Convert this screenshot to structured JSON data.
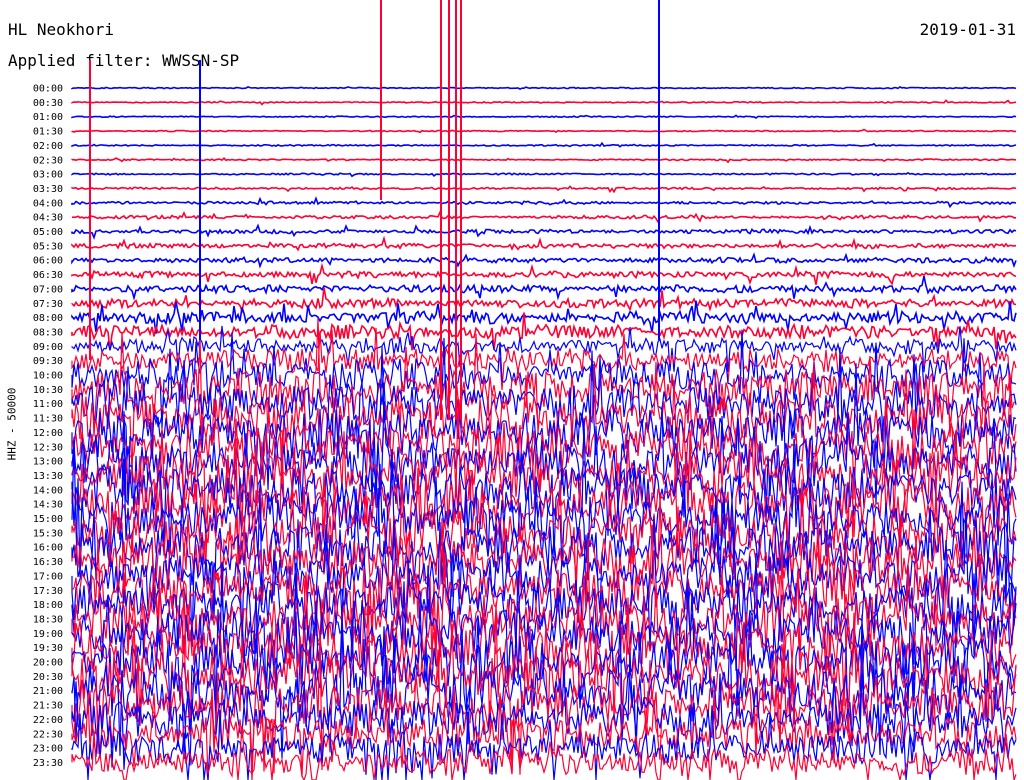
{
  "header": {
    "station": "HL Neokhori",
    "filter": "Applied filter: WWSSN-SP",
    "date": "2019-01-31"
  },
  "chart_data": {
    "type": "helicorder",
    "title": "HL Neokhori",
    "subtitle": "Applied filter: WWSSN-SP",
    "date": "2019-01-31",
    "ylabel": "HHZ - 50000",
    "xlabel": "",
    "trace_colors": [
      "#0000ff",
      "#ff0033"
    ],
    "tick_labels": [
      "00:00",
      "00:30",
      "01:00",
      "01:30",
      "02:00",
      "02:30",
      "03:00",
      "03:30",
      "04:00",
      "04:30",
      "05:00",
      "05:30",
      "06:00",
      "06:30",
      "07:00",
      "07:30",
      "08:00",
      "08:30",
      "09:00",
      "09:30",
      "10:00",
      "10:30",
      "11:00",
      "11:30",
      "12:00",
      "12:30",
      "13:00",
      "13:30",
      "14:00",
      "14:30",
      "15:00",
      "15:30",
      "16:00",
      "16:30",
      "17:00",
      "17:30",
      "18:00",
      "18:30",
      "19:00",
      "19:30",
      "20:00",
      "20:30",
      "21:00",
      "21:30",
      "22:00",
      "22:30",
      "23:00",
      "23:30"
    ],
    "noise_level": [
      0.3,
      0.3,
      0.3,
      0.3,
      0.35,
      0.35,
      0.4,
      0.5,
      0.7,
      0.8,
      1.0,
      1.2,
      1.3,
      1.6,
      1.9,
      2.3,
      3.0,
      3.5,
      4.0,
      6.0,
      8.0,
      10,
      11,
      12,
      12,
      12,
      12,
      12,
      12,
      12,
      12,
      12,
      12,
      12,
      12,
      12,
      12,
      12,
      12,
      12,
      12,
      12,
      12,
      11,
      10,
      9,
      8,
      7
    ]
  }
}
